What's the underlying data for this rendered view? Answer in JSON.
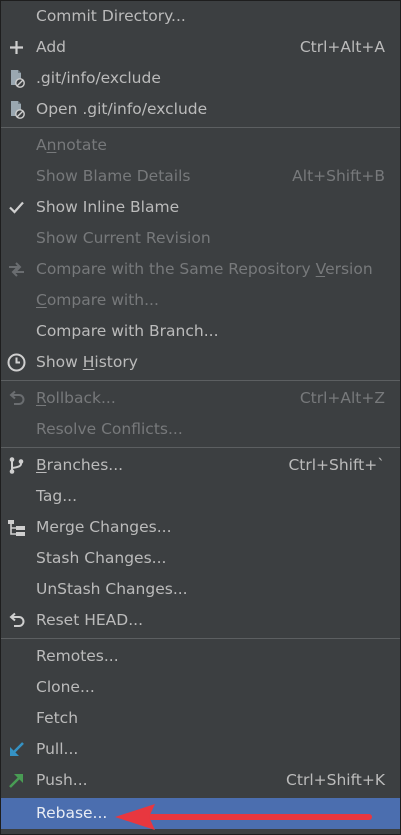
{
  "menu": {
    "commit_directory": "Commit Directory...",
    "add": {
      "label": "Add",
      "shortcut": "Ctrl+Alt+A"
    },
    "git_info_exclude": ".git/info/exclude",
    "open_git_info_exclude": "Open .git/info/exclude",
    "annotate": {
      "pre": "A",
      "u": "n",
      "post": "notate"
    },
    "show_blame_details": {
      "label": "Show Blame Details",
      "shortcut": "Alt+Shift+B"
    },
    "show_inline_blame": "Show Inline Blame",
    "show_current_revision": "Show Current Revision",
    "compare_same_repo": {
      "pre": "Compare with the Same Repository ",
      "u": "V",
      "post": "ersion"
    },
    "compare_with": {
      "u": "C",
      "post": "ompare with..."
    },
    "compare_with_branch": "Compare with Branch...",
    "show_history": {
      "pre": "Show ",
      "u": "H",
      "post": "istory"
    },
    "rollback": {
      "u": "R",
      "post": "ollback...",
      "shortcut": "Ctrl+Alt+Z"
    },
    "resolve_conflicts": "Resolve Conflicts...",
    "branches": {
      "u": "B",
      "post": "ranches...",
      "shortcut": "Ctrl+Shift+`"
    },
    "tag": "Tag...",
    "merge_changes": "Merge Changes...",
    "stash_changes": "Stash Changes...",
    "unstash_changes": "UnStash Changes...",
    "reset_head": "Reset HEAD...",
    "remotes": "Remotes...",
    "clone": "Clone...",
    "fetch": "Fetch",
    "pull": "Pull...",
    "push": {
      "label": "Push...",
      "shortcut": "Ctrl+Shift+K"
    },
    "rebase": "Rebase..."
  },
  "icons": {
    "add": "plus-icon",
    "exclude_file": "excluded-file-icon",
    "checkmark": "checkmark-icon",
    "compare": "compare-arrows-icon",
    "history": "clock-icon",
    "rollback": "undo-icon",
    "branches": "branch-icon",
    "merge": "merge-icon",
    "reset": "undo-icon",
    "pull": "pull-arrow-icon",
    "push": "push-arrow-icon",
    "annotation_arrow": "red-arrow-annotation"
  },
  "colors": {
    "menu_bg": "#3c3f41",
    "text": "#bbbbbb",
    "disabled_text": "#77797b",
    "selection": "#4b6eaf",
    "pull_icon": "#3592c4",
    "push_icon": "#499c54",
    "annotation_arrow": "#e8373f"
  }
}
